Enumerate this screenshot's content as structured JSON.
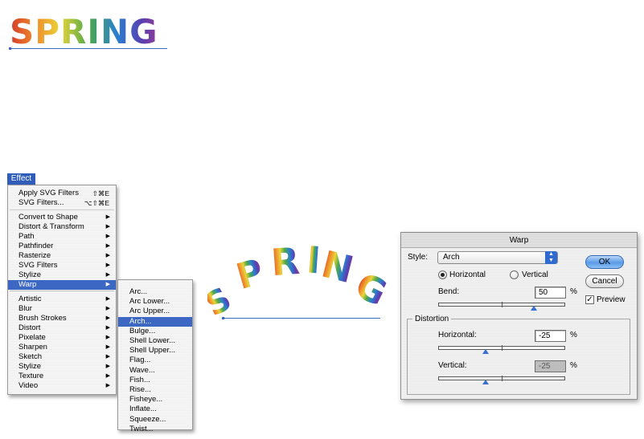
{
  "top_word": {
    "text": "SPRING"
  },
  "arch_word": {
    "letters": [
      "S",
      "P",
      "R",
      "I",
      "N",
      "G"
    ]
  },
  "effect_menu": {
    "title": "Effect",
    "items": [
      {
        "label": "Apply SVG Filters",
        "shortcut": "⇧⌘E"
      },
      {
        "label": "SVG Filters...",
        "shortcut": "⌥⇧⌘E"
      },
      {
        "label": "Convert to Shape",
        "submenu": true
      },
      {
        "label": "Distort & Transform",
        "submenu": true
      },
      {
        "label": "Path",
        "submenu": true
      },
      {
        "label": "Pathfinder",
        "submenu": true
      },
      {
        "label": "Rasterize",
        "submenu": true
      },
      {
        "label": "SVG Filters",
        "submenu": true
      },
      {
        "label": "Stylize",
        "submenu": true
      },
      {
        "label": "Warp",
        "submenu": true,
        "selected": true
      },
      {
        "label": "Artistic",
        "submenu": true
      },
      {
        "label": "Blur",
        "submenu": true
      },
      {
        "label": "Brush Strokes",
        "submenu": true
      },
      {
        "label": "Distort",
        "submenu": true
      },
      {
        "label": "Pixelate",
        "submenu": true
      },
      {
        "label": "Sharpen",
        "submenu": true
      },
      {
        "label": "Sketch",
        "submenu": true
      },
      {
        "label": "Stylize",
        "submenu": true
      },
      {
        "label": "Texture",
        "submenu": true
      },
      {
        "label": "Video",
        "submenu": true
      }
    ]
  },
  "warp_submenu": {
    "items": [
      {
        "label": "Arc..."
      },
      {
        "label": "Arc Lower..."
      },
      {
        "label": "Arc Upper..."
      },
      {
        "label": "Arch...",
        "selected": true
      },
      {
        "label": "Bulge..."
      },
      {
        "label": "Shell Lower..."
      },
      {
        "label": "Shell Upper..."
      },
      {
        "label": "Flag..."
      },
      {
        "label": "Wave..."
      },
      {
        "label": "Fish..."
      },
      {
        "label": "Rise..."
      },
      {
        "label": "Fisheye..."
      },
      {
        "label": "Inflate..."
      },
      {
        "label": "Squeeze..."
      },
      {
        "label": "Twist..."
      }
    ]
  },
  "warp_dialog": {
    "title": "Warp",
    "style_label": "Style:",
    "style_value": "Arch",
    "orientation": {
      "horizontal_label": "Horizontal",
      "vertical_label": "Vertical",
      "selected": "horizontal"
    },
    "bend": {
      "label": "Bend:",
      "value": "50",
      "unit": "%",
      "slider_value": 50
    },
    "distortion": {
      "group_label": "Distortion",
      "horizontal": {
        "label": "Horizontal:",
        "value": "-25",
        "unit": "%",
        "slider_value": -25
      },
      "vertical": {
        "label": "Vertical:",
        "value": "-25",
        "unit": "%",
        "slider_value": -25,
        "disabled": true
      }
    },
    "ok_label": "OK",
    "cancel_label": "Cancel",
    "preview_label": "Preview",
    "preview_checked": true,
    "accent_color": "#3a6fd0"
  }
}
